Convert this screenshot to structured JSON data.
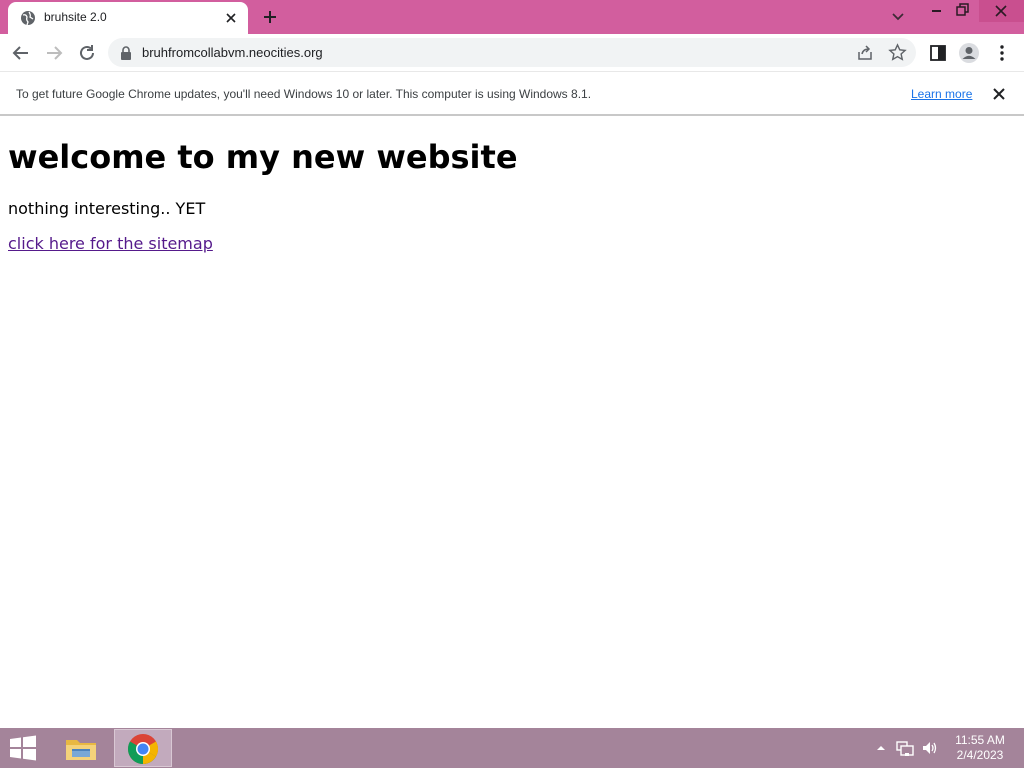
{
  "browser": {
    "tab": {
      "title": "bruhsite 2.0"
    },
    "address_bar": {
      "url": "bruhfromcollabvm.neocities.org"
    }
  },
  "infobar": {
    "message": "To get future Google Chrome updates, you'll need Windows 10 or later. This computer is using Windows 8.1.",
    "link_label": "Learn more"
  },
  "page": {
    "heading": "welcome to my new website",
    "paragraph": "nothing interesting.. YET",
    "link_text": "click here for the sitemap"
  },
  "taskbar": {
    "time": "11:55 AM",
    "date": "2/4/2023"
  },
  "colors": {
    "titlebar": "#d25e9e",
    "taskbar": "#a4849a",
    "link_visited": "#551a8b",
    "info_link": "#1a73e8"
  },
  "icons": {
    "tab": [
      "globe-icon",
      "close-icon",
      "plus-icon",
      "chevron-down-icon"
    ],
    "window": [
      "minimize-icon",
      "restore-icon",
      "close-icon"
    ],
    "toolbar": [
      "back-arrow-icon",
      "forward-arrow-icon",
      "reload-icon",
      "lock-icon",
      "share-icon",
      "star-icon",
      "side-panel-icon",
      "profile-icon",
      "more-vert-icon"
    ],
    "taskbar": [
      "windows-logo-icon",
      "file-explorer-icon",
      "chrome-icon",
      "tray-arrow-icon",
      "network-icon",
      "volume-icon"
    ]
  }
}
